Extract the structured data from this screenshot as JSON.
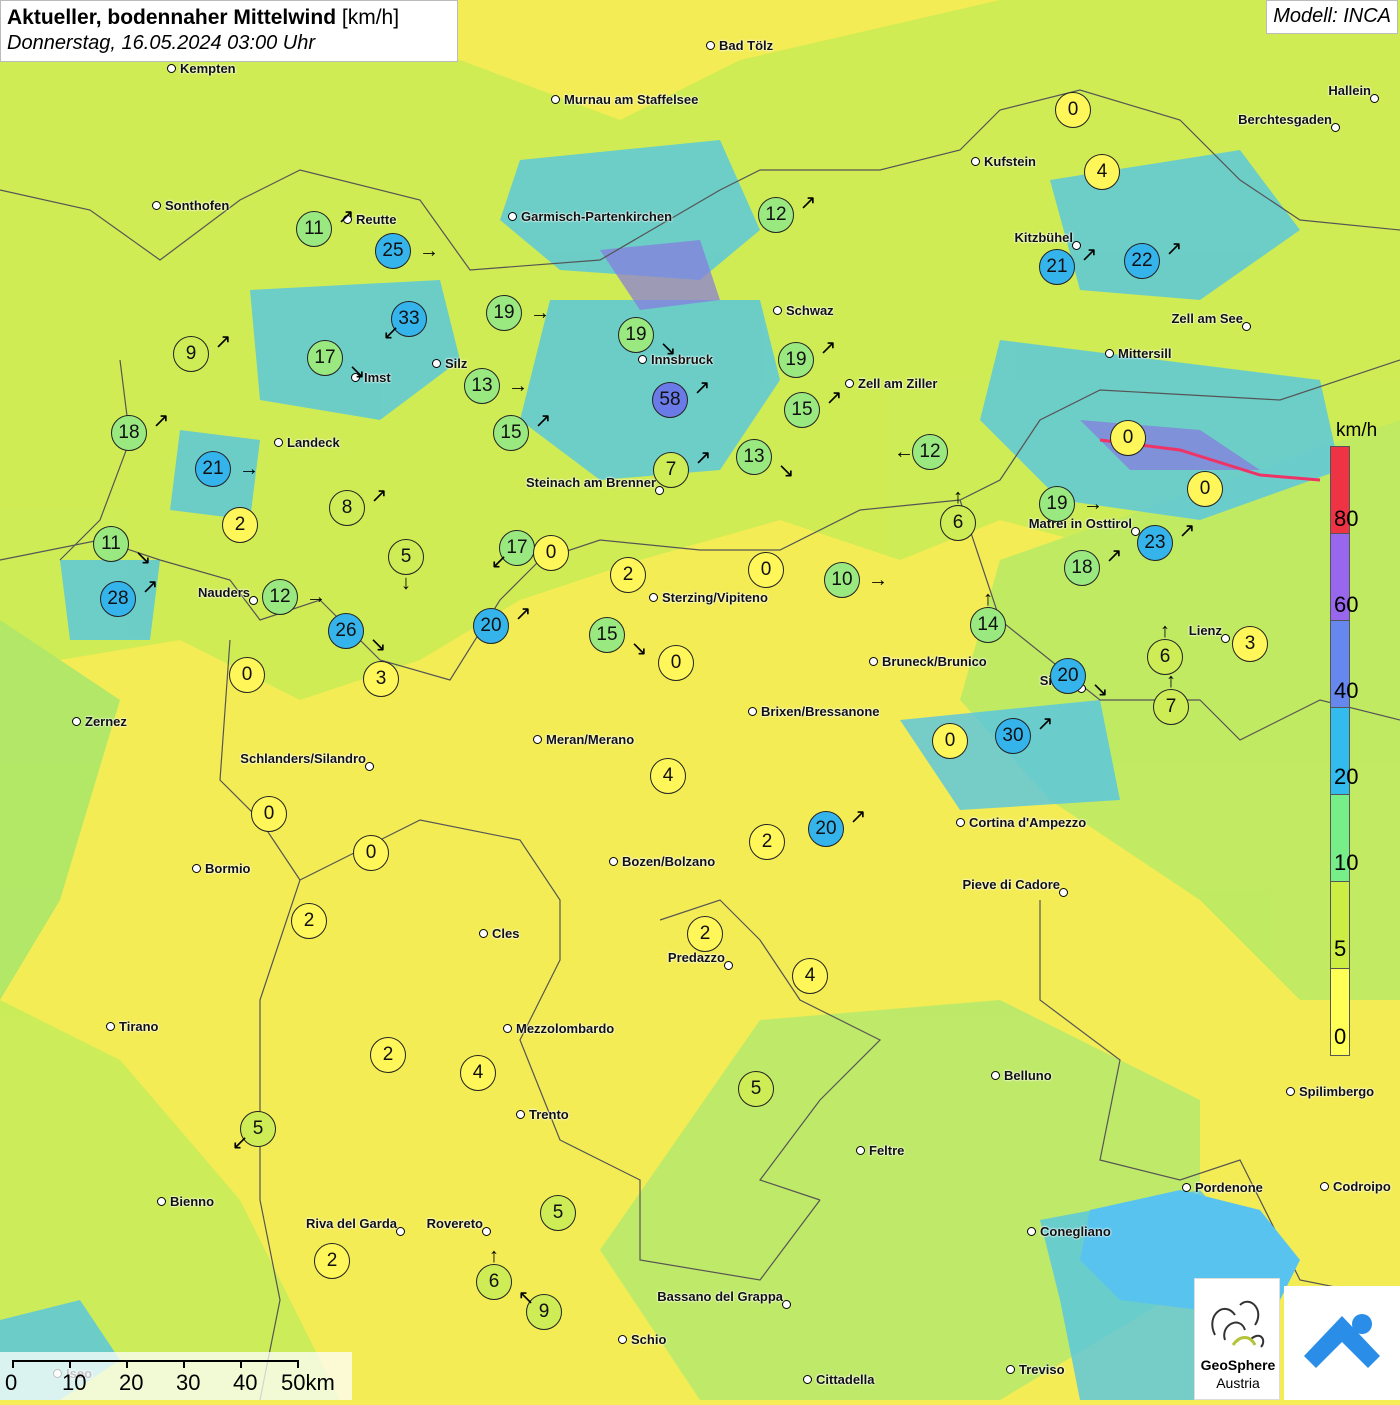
{
  "title": {
    "main": "Aktueller, bodennaher Mittelwind",
    "unit": "[km/h]",
    "sub": "Donnerstag, 16.05.2024 03:00 Uhr"
  },
  "model": "Modell: INCA",
  "legend": {
    "unit": "km/h",
    "ticks": [
      "80",
      "60",
      "40",
      "20",
      "10",
      "5",
      "0"
    ],
    "colors": [
      "#ee3344",
      "#9966ee",
      "#6688ee",
      "#33bbee",
      "#77ee88",
      "#ccee44",
      "#ffff55"
    ]
  },
  "cities": [
    {
      "name": "Kempten"
    },
    {
      "name": "Bad Tölz"
    },
    {
      "name": "Murnau am Staffelsee"
    },
    {
      "name": "Hallein"
    },
    {
      "name": "Berchtesgaden"
    },
    {
      "name": "Kufstein"
    },
    {
      "name": "Sonthofen"
    },
    {
      "name": "Reutte"
    },
    {
      "name": "Garmisch-Partenkirchen"
    },
    {
      "name": "Kitzbühel"
    },
    {
      "name": "Schwaz"
    },
    {
      "name": "Zell am See"
    },
    {
      "name": "Silz"
    },
    {
      "name": "Innsbruck"
    },
    {
      "name": "Mittersill"
    },
    {
      "name": "Imst"
    },
    {
      "name": "Zell am Ziller"
    },
    {
      "name": "Landeck"
    },
    {
      "name": "Steinach am Brenner"
    },
    {
      "name": "Matrei in Osttirol"
    },
    {
      "name": "Nauders"
    },
    {
      "name": "Sterzing/Vipiteno"
    },
    {
      "name": "Lienz"
    },
    {
      "name": "Bruneck/Brunico"
    },
    {
      "name": "Sillian"
    },
    {
      "name": "Zernez"
    },
    {
      "name": "Brixen/Bressanone"
    },
    {
      "name": "Meran/Merano"
    },
    {
      "name": "Schlanders/Silandro"
    },
    {
      "name": "Cortina d'Ampezzo"
    },
    {
      "name": "Bormio"
    },
    {
      "name": "Bozen/Bolzano"
    },
    {
      "name": "Pieve di Cadore"
    },
    {
      "name": "Cles"
    },
    {
      "name": "Predazzo"
    },
    {
      "name": "Tirano"
    },
    {
      "name": "Mezzolombardo"
    },
    {
      "name": "Belluno"
    },
    {
      "name": "Spilimbergo"
    },
    {
      "name": "Trento"
    },
    {
      "name": "Feltre"
    },
    {
      "name": "Pordenone"
    },
    {
      "name": "Codroipo"
    },
    {
      "name": "Bienno"
    },
    {
      "name": "Riva del Garda"
    },
    {
      "name": "Rovereto"
    },
    {
      "name": "Conegliano"
    },
    {
      "name": "Bassano del Grappa"
    },
    {
      "name": "Schio"
    },
    {
      "name": "Treviso"
    },
    {
      "name": "Cittadella"
    },
    {
      "name": "Iseo"
    }
  ],
  "stations": [
    {
      "value": "0",
      "dir": "none"
    },
    {
      "value": "4",
      "dir": "none"
    },
    {
      "value": "11",
      "dir": "↗"
    },
    {
      "value": "25",
      "dir": "→"
    },
    {
      "value": "12",
      "dir": "↗"
    },
    {
      "value": "21",
      "dir": "↗"
    },
    {
      "value": "22",
      "dir": "↗"
    },
    {
      "value": "33",
      "dir": "↙"
    },
    {
      "value": "19",
      "dir": "→"
    },
    {
      "value": "19",
      "dir": "↘"
    },
    {
      "value": "9",
      "dir": "↗"
    },
    {
      "value": "17",
      "dir": "↘"
    },
    {
      "value": "13",
      "dir": "→"
    },
    {
      "value": "19",
      "dir": "↗"
    },
    {
      "value": "15",
      "dir": "↗"
    },
    {
      "value": "58",
      "dir": "↗"
    },
    {
      "value": "18",
      "dir": "↗"
    },
    {
      "value": "15",
      "dir": "↗"
    },
    {
      "value": "0",
      "dir": "none"
    },
    {
      "value": "21",
      "dir": "→"
    },
    {
      "value": "7",
      "dir": "↗"
    },
    {
      "value": "13",
      "dir": "↘"
    },
    {
      "value": "12",
      "dir": "←"
    },
    {
      "value": "0",
      "dir": "none"
    },
    {
      "value": "8",
      "dir": "↗"
    },
    {
      "value": "19",
      "dir": "→"
    },
    {
      "value": "2",
      "dir": "none"
    },
    {
      "value": "6",
      "dir": "↑"
    },
    {
      "value": "11",
      "dir": "↘"
    },
    {
      "value": "5",
      "dir": "↓"
    },
    {
      "value": "17",
      "dir": "↙"
    },
    {
      "value": "0",
      "dir": "none"
    },
    {
      "value": "23",
      "dir": "↗"
    },
    {
      "value": "2",
      "dir": "none"
    },
    {
      "value": "0",
      "dir": "none"
    },
    {
      "value": "10",
      "dir": "→"
    },
    {
      "value": "18",
      "dir": "↗"
    },
    {
      "value": "28",
      "dir": "↗"
    },
    {
      "value": "12",
      "dir": "→"
    },
    {
      "value": "26",
      "dir": "↘"
    },
    {
      "value": "20",
      "dir": "↗"
    },
    {
      "value": "15",
      "dir": "↘"
    },
    {
      "value": "14",
      "dir": "↑"
    },
    {
      "value": "6",
      "dir": "↑"
    },
    {
      "value": "3",
      "dir": "none"
    },
    {
      "value": "0",
      "dir": "none"
    },
    {
      "value": "3",
      "dir": "none"
    },
    {
      "value": "0",
      "dir": "none"
    },
    {
      "value": "20",
      "dir": "↘"
    },
    {
      "value": "7",
      "dir": "↑"
    },
    {
      "value": "0",
      "dir": "none"
    },
    {
      "value": "30",
      "dir": "↗"
    },
    {
      "value": "4",
      "dir": "none"
    },
    {
      "value": "0",
      "dir": "none"
    },
    {
      "value": "2",
      "dir": "none"
    },
    {
      "value": "20",
      "dir": "↗"
    },
    {
      "value": "0",
      "dir": "none"
    },
    {
      "value": "2",
      "dir": "none"
    },
    {
      "value": "2",
      "dir": "none"
    },
    {
      "value": "4",
      "dir": "none"
    },
    {
      "value": "2",
      "dir": "none"
    },
    {
      "value": "4",
      "dir": "none"
    },
    {
      "value": "5",
      "dir": "none"
    },
    {
      "value": "5",
      "dir": "↙"
    },
    {
      "value": "5",
      "dir": "none"
    },
    {
      "value": "2",
      "dir": "none"
    },
    {
      "value": "6",
      "dir": "↑"
    },
    {
      "value": "9",
      "dir": "↖"
    }
  ],
  "scale": {
    "labels": [
      "0",
      "10",
      "20",
      "30",
      "40",
      "50km"
    ]
  },
  "logo": {
    "line1": "GeoSphere",
    "line2": "Austria"
  }
}
